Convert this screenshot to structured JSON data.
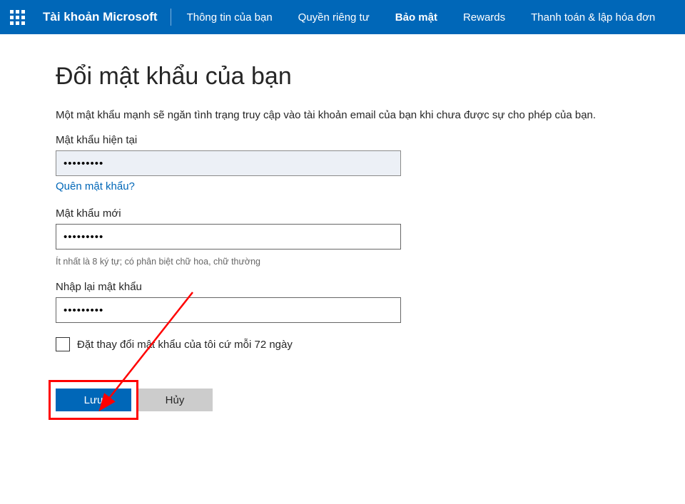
{
  "header": {
    "brand": "Tài khoản Microsoft",
    "nav": [
      {
        "label": "Thông tin của bạn",
        "active": false
      },
      {
        "label": "Quyền riêng tư",
        "active": false
      },
      {
        "label": "Bảo mật",
        "active": true
      },
      {
        "label": "Rewards",
        "active": false
      },
      {
        "label": "Thanh toán & lập hóa đơn",
        "active": false
      }
    ]
  },
  "page": {
    "title": "Đổi mật khẩu của bạn",
    "description": "Một mật khẩu mạnh sẽ ngăn tình trạng truy cập vào tài khoản email của bạn khi chưa được sự cho phép của bạn.",
    "current_password": {
      "label": "Mật khẩu hiện tại",
      "value": "•••••••••",
      "forgot_link": "Quên mật khẩu?"
    },
    "new_password": {
      "label": "Mật khẩu mới",
      "value": "•••••••••",
      "hint": "Ít nhất là 8 ký tự; có phân biệt chữ hoa, chữ thường"
    },
    "confirm_password": {
      "label": "Nhập lại mật khẩu",
      "value": "•••••••••"
    },
    "checkbox_label": "Đặt thay đổi mật khẩu của tôi cứ mỗi 72 ngày",
    "save_button": "Lưu",
    "cancel_button": "Hủy"
  }
}
